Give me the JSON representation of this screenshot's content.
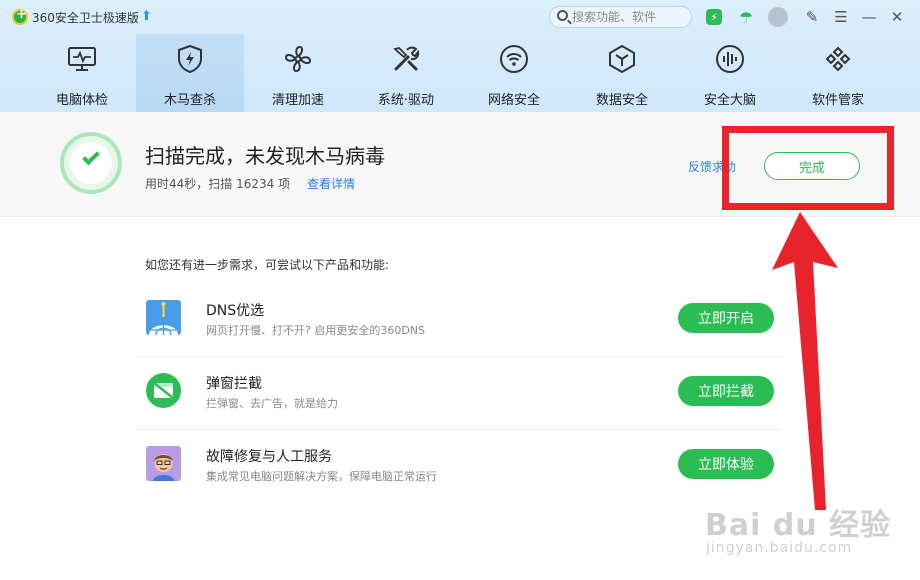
{
  "app": {
    "title": "360安全卫士极速版",
    "search_placeholder": "搜索功能、软件"
  },
  "nav": {
    "items": [
      {
        "label": "电脑体检",
        "icon": "monitor-pulse-icon"
      },
      {
        "label": "木马查杀",
        "icon": "shield-bolt-icon"
      },
      {
        "label": "清理加速",
        "icon": "fan-icon"
      },
      {
        "label": "系统·驱动",
        "icon": "tools-icon"
      },
      {
        "label": "网络安全",
        "icon": "wifi-icon"
      },
      {
        "label": "数据安全",
        "icon": "hexagon-icon"
      },
      {
        "label": "安全大脑",
        "icon": "brain-wave-icon"
      },
      {
        "label": "软件管家",
        "icon": "apps-icon"
      }
    ],
    "active_index": 1
  },
  "result": {
    "title": "扫描完成，未发现木马病毒",
    "subtitle": "用时44秒，扫描 16234 项",
    "detail_link": "查看详情",
    "feedback_link": "反馈求助",
    "done_button": "完成"
  },
  "recommendations": {
    "intro": "如您还有进一步需求，可尝试以下产品和功能:",
    "items": [
      {
        "title": "DNS优选",
        "desc": "网页打开慢、打不开? 启用更安全的360DNS",
        "button": "立即开启",
        "icon": "dns-globe-icon"
      },
      {
        "title": "弹窗拦截",
        "desc": "拦弹窗、去广告，就是给力",
        "button": "立即拦截",
        "icon": "popup-block-icon"
      },
      {
        "title": "故障修复与人工服务",
        "desc": "集成常见电脑问题解决方案，保障电脑正常运行",
        "button": "立即体验",
        "icon": "support-person-icon"
      }
    ]
  },
  "watermark": {
    "logo": "Bai du 经验",
    "url": "jingyan.baidu.com"
  },
  "colors": {
    "accent_green": "#2bbd54",
    "link_blue": "#2a7fdc",
    "annotation_red": "#e8232b",
    "header_blue": "#d4eafb"
  }
}
